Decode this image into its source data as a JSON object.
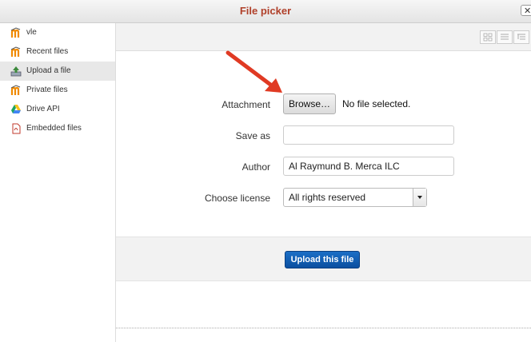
{
  "titlebar": {
    "title": "File picker",
    "close_glyph": "✕"
  },
  "sidebar": {
    "items": [
      {
        "label": "vle",
        "icon": "moodle-icon"
      },
      {
        "label": "Recent files",
        "icon": "moodle-icon"
      },
      {
        "label": "Upload a file",
        "icon": "upload-icon",
        "active": true
      },
      {
        "label": "Private files",
        "icon": "moodle-icon"
      },
      {
        "label": "Drive API",
        "icon": "google-drive-icon"
      },
      {
        "label": "Embedded files",
        "icon": "embedded-file-icon"
      }
    ]
  },
  "toolbar": {
    "view_buttons": [
      "grid-view-icon",
      "list-view-icon",
      "tree-view-icon"
    ]
  },
  "form": {
    "attachment_label": "Attachment",
    "browse_label": "Browse…",
    "no_file_text": "No file selected.",
    "save_as_label": "Save as",
    "save_as_value": "",
    "author_label": "Author",
    "author_value": "Al Raymund B. Merca ILC",
    "license_label": "Choose license",
    "license_value": "All rights reserved"
  },
  "footer": {
    "upload_label": "Upload this file"
  },
  "colors": {
    "title": "#b0402a",
    "accent_button": "#0b4fa0",
    "arrow": "#e03a23",
    "active_item_bg": "#e8e8e8"
  }
}
